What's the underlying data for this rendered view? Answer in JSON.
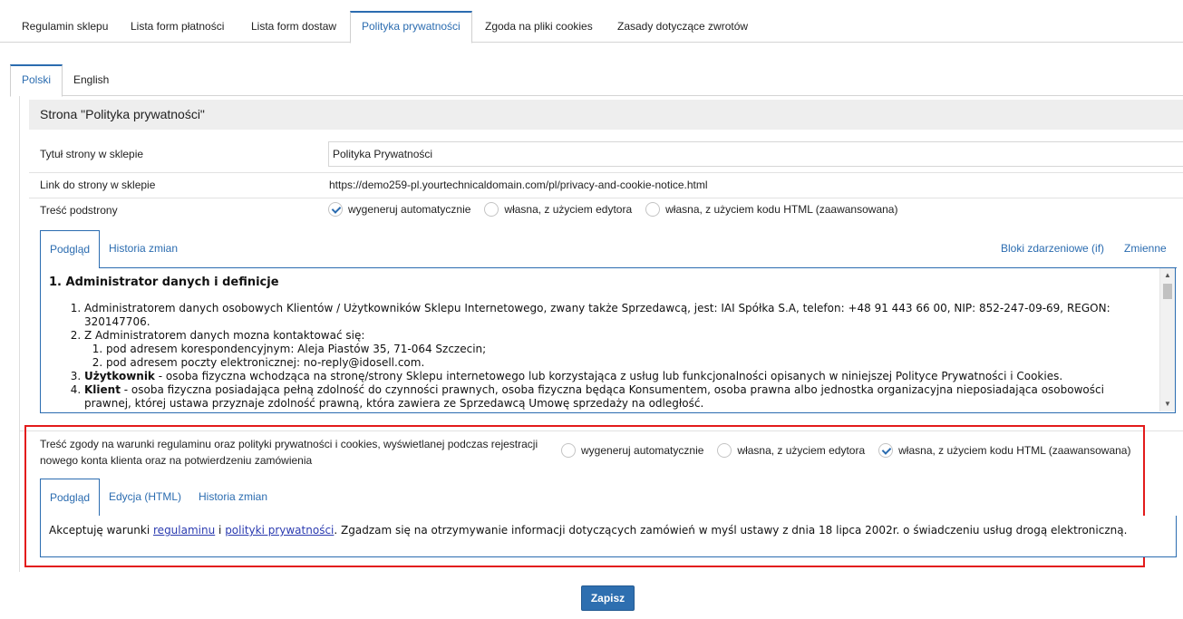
{
  "top_tabs": [
    "Regulamin sklepu",
    "Lista form płatności",
    "Lista form dostaw",
    "Polityka prywatności",
    "Zgoda na pliki cookies",
    "Zasady dotyczące zwrotów"
  ],
  "lang_tabs": [
    "Polski",
    "English"
  ],
  "section_title": "Strona \"Polityka prywatności\"",
  "form": {
    "title_label": "Tytuł strony w sklepie",
    "title_value": "Polityka Prywatności",
    "link_label": "Link do strony w sklepie",
    "link_value": "https://demo259-pl.yourtechnicaldomain.com/pl/privacy-and-cookie-notice.html",
    "content_label": "Treść podstrony",
    "content_options": [
      "wygeneruj automatycznie",
      "własna, z użyciem edytora",
      "własna, z użyciem kodu HTML (zaawansowana)"
    ],
    "content_selected": "wygeneruj automatycznie"
  },
  "content_tabs": {
    "preview": "Podgląd",
    "history": "Historia zmian",
    "event_blocks": "Bloki zdarzeniowe (if)",
    "variables": "Zmienne"
  },
  "policy_preview": {
    "heading": "1. Administrator danych i definicje",
    "item1": "Administratorem danych osobowych Klientów / Użytkowników Sklepu Internetowego, zwany także Sprzedawcą, jest: IAI Spółka S.A, telefon: +48 91 443 66 00, NIP: 852-247-09-69, REGON: 320147706.",
    "item2": "Z Administratorem danych mozna kontaktować się:",
    "item2a": "pod adresem korespondencyjnym: Aleja Piastów 35, 71-064 Szczecin;",
    "item2b": "pod adresem poczty elektronicznej: no-reply@idosell.com.",
    "item3_term": "Użytkownik",
    "item3_text": " - osoba fizyczna wchodząca na stronę/strony Sklepu internetowego lub korzystająca z usług lub funkcjonalności opisanych w niniejszej Polityce Prywatności i Cookies.",
    "item4_term": "Klient",
    "item4_text": " - osoba fizyczna posiadająca pełną zdolność do czynności prawnych, osoba fizyczna będąca Konsumentem, osoba prawna albo jednostka organizacyjna nieposiadająca osobowości prawnej, której ustawa przyznaje zdolność prawną, która zawiera ze Sprzedawcą Umowę sprzedaży na odległość."
  },
  "consent": {
    "label": "Treść zgody na warunki regulaminu oraz polityki prywatności i cookies, wyświetlanej podczas rejestracji nowego konta klienta oraz na potwierdzeniu zamówienia",
    "options": [
      "wygeneruj automatycznie",
      "własna, z użyciem edytora",
      "własna, z użyciem kodu HTML (zaawansowana)"
    ],
    "selected": "własna, z użyciem kodu HTML (zaawansowana)",
    "tabs": [
      "Podgląd",
      "Edycja (HTML)",
      "Historia zmian"
    ],
    "text_before": "Akceptuję warunki ",
    "link1": "regulaminu",
    "text_mid": " i ",
    "link2": "polityki prywatności",
    "text_after": ". Zgadzam się na otrzymywanie informacji dotyczących zamówień w myśl ustawy z dnia 18 lipca 2002r. o świadczeniu usług drogą elektroniczną."
  },
  "save_button": "Zapisz",
  "colors": {
    "accent": "#2b6cb0",
    "highlight_border": "#e31b1b",
    "save_bg": "#2e6fb0"
  }
}
